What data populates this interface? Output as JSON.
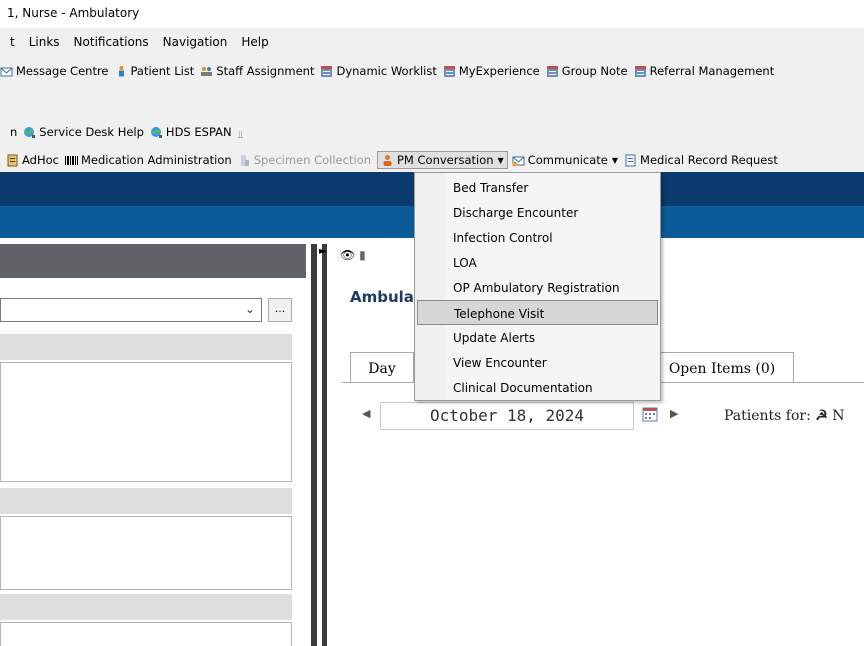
{
  "window": {
    "title": "1, Nurse - Ambulatory"
  },
  "menubar": {
    "items": [
      "t",
      "Links",
      "Notifications",
      "Navigation",
      "Help"
    ]
  },
  "toolbar1": {
    "items": [
      {
        "label": "Message Centre",
        "icon": "message-icon"
      },
      {
        "label": "Patient List",
        "icon": "patient-icon"
      },
      {
        "label": "Staff Assignment",
        "icon": "staff-icon"
      },
      {
        "label": "Dynamic Worklist",
        "icon": "worklist-icon"
      },
      {
        "label": "MyExperience",
        "icon": "worklist-icon"
      },
      {
        "label": "Group Note",
        "icon": "worklist-icon"
      },
      {
        "label": "Referral Management",
        "icon": "worklist-icon"
      }
    ]
  },
  "toolbar2": {
    "prefix": "n",
    "items": [
      {
        "label": "Service Desk Help",
        "icon": "globe-icon"
      },
      {
        "label": "HDS ESPAN",
        "icon": "globe-icon"
      }
    ]
  },
  "toolbar3": {
    "items": [
      {
        "label": "AdHoc",
        "icon": "adhoc-icon"
      },
      {
        "label": "Medication Administration",
        "icon": "barcode-icon"
      },
      {
        "label": "Specimen Collection",
        "icon": "specimen-icon",
        "disabled": true
      },
      {
        "label": "PM Conversation",
        "icon": "person-icon",
        "dropdown": true
      },
      {
        "label": "Communicate",
        "icon": "communicate-icon",
        "dropdown": true
      },
      {
        "label": "Medical Record Request",
        "icon": "document-icon"
      }
    ]
  },
  "pm_menu": {
    "items": [
      "Bed Transfer",
      "Discharge Encounter",
      "Infection Control",
      "LOA",
      "OP Ambulatory Registration",
      "Telephone Visit",
      "Update Alerts",
      "View Encounter",
      "Clinical Documentation"
    ],
    "highlighted_index": 5
  },
  "left_pane": {
    "select_value": "",
    "browse_button": "..."
  },
  "right_pane": {
    "title": "Ambula",
    "tabs": [
      "Day",
      "Open Items (0)"
    ],
    "date": "October 18, 2024",
    "patients_label": "Patients for:",
    "patients_value": "N"
  },
  "colors": {
    "dark_blue": "#0b3a6e",
    "mid_blue": "#0c5c99",
    "pane_header": "#5f6368"
  }
}
